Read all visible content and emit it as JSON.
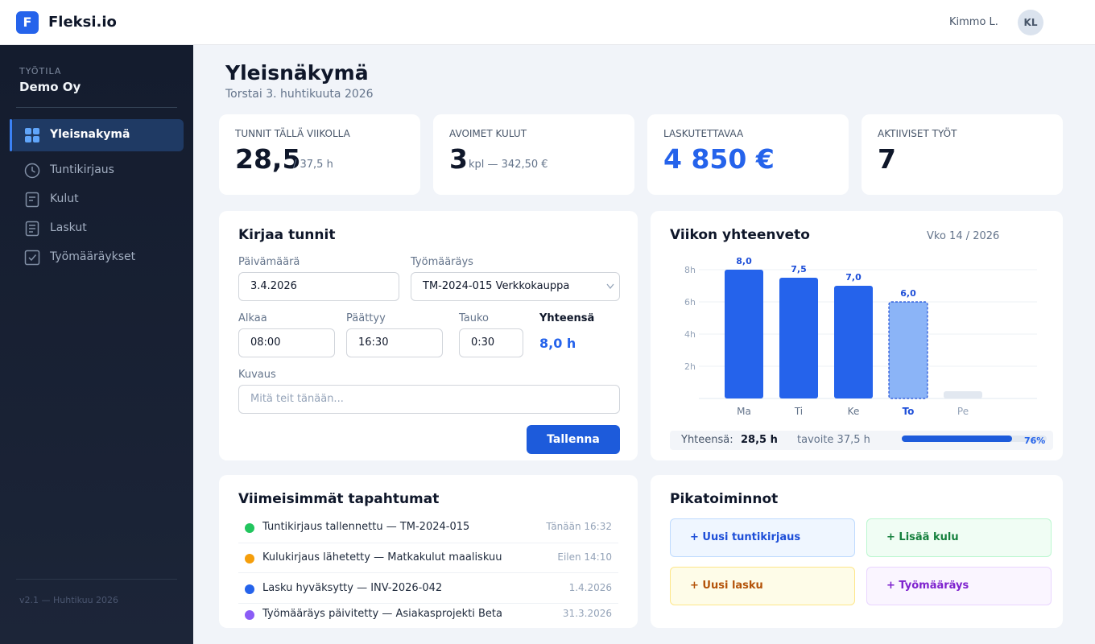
{
  "app": {
    "logo_letter": "F",
    "name": "Fleksi.io"
  },
  "user": {
    "name": "Kimmo L.",
    "initials": "KL"
  },
  "sidebar": {
    "workspace_label": "TYÖTILA",
    "workspace_name": "Demo Oy",
    "items": [
      {
        "label": "Yleisnakymä",
        "icon": "grid-icon"
      },
      {
        "label": "Tuntikirjaus",
        "icon": "clock-icon"
      },
      {
        "label": "Kulut",
        "icon": "document-icon"
      },
      {
        "label": "Laskut",
        "icon": "invoice-icon"
      },
      {
        "label": "Työmääräykset",
        "icon": "checkbox-icon"
      }
    ],
    "version": "v2.1 — Huhtikuu 2026"
  },
  "page": {
    "title": "Yleisnäkymä",
    "subtitle": "Torstai 3. huhtikuuta 2026"
  },
  "stats": [
    {
      "label": "TUNNIT TÄLLÄ VIIKOLLA",
      "value": "28,5",
      "suffix": "/ 37,5 h"
    },
    {
      "label": "AVOIMET KULUT",
      "value": "3",
      "suffix": "kpl — 342,50 €"
    },
    {
      "label": "LASKUTETTAVAA",
      "value": "4 850 €",
      "suffix": ""
    },
    {
      "label": "AKTIIVISET TYÖT",
      "value": "7",
      "suffix": ""
    }
  ],
  "colors": {
    "accent": "#2563eb",
    "sidebar_bg": "#1a2234"
  },
  "form": {
    "title": "Kirjaa tunnit",
    "date_label": "Päivämäärä",
    "date_value": "3.4.2026",
    "order_label": "Työmääräys",
    "order_value": "TM-2024-015 Verkkokauppa",
    "start_label": "Alkaa",
    "start_value": "08:00",
    "end_label": "Päättyy",
    "end_value": "16:30",
    "break_label": "Tauko",
    "break_value": "0:30",
    "total_label": "Yhteensä",
    "total_value": "8,0 h",
    "desc_label": "Kuvaus",
    "desc_placeholder": "Mitä teit tänään...",
    "save_label": "Tallenna"
  },
  "summary": {
    "title": "Viikon yhteenveto",
    "week": "Vko 14 / 2026",
    "total_label": "Yhteensä:",
    "total_value": "28,5 h",
    "target_label": "tavoite 37,5 h",
    "progress_pct": "76%",
    "progress": 0.76
  },
  "chart_data": {
    "type": "bar",
    "categories": [
      "Ma",
      "Ti",
      "Ke",
      "To",
      "Pe"
    ],
    "values": [
      8.0,
      7.5,
      7.0,
      6.0,
      null
    ],
    "data_labels": [
      "8,0",
      "7,5",
      "7,0",
      "6,0",
      ""
    ],
    "highlighted_category": "To",
    "y_ticks": [
      "2h",
      "4h",
      "6h",
      "8h"
    ],
    "ylim": [
      0,
      8
    ],
    "grid": true
  },
  "events": {
    "title": "Viimeisimmät tapahtumat",
    "items": [
      {
        "text": "Tuntikirjaus tallennettu — TM-2024-015",
        "time": "Tänään 16:32",
        "color": "#22c55e"
      },
      {
        "text": "Kulukirjaus lähetetty — Matkakulut maaliskuu",
        "time": "Eilen 14:10",
        "color": "#f59e0b"
      },
      {
        "text": "Lasku hyväksytty — INV-2026-042",
        "time": "1.4.2026",
        "color": "#2563eb"
      },
      {
        "text": "Työmääräys päivitetty — Asiakasprojekti Beta",
        "time": "31.3.2026",
        "color": "#8b5cf6"
      }
    ]
  },
  "quick": {
    "title": "Pikatoiminnot",
    "actions": [
      {
        "label": "+ Uusi tuntikirjaus",
        "color": "#1d4ed8"
      },
      {
        "label": "+ Lisää kulu",
        "color": "#15803d"
      },
      {
        "label": "+ Uusi lasku",
        "color": "#b45309"
      },
      {
        "label": "+ Työmääräys",
        "color": "#7e22ce"
      }
    ]
  }
}
